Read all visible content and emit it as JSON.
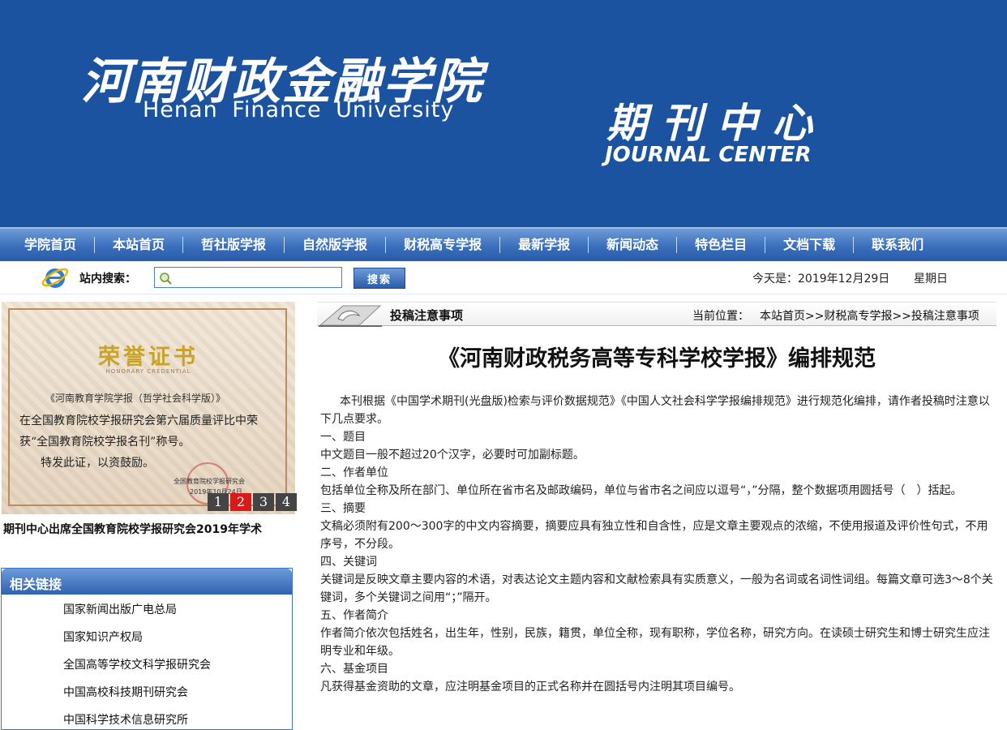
{
  "banner": {
    "logo_cn": "河南财政金融学院",
    "logo_en": "Henan Finance University",
    "center_cn": "期刊中心",
    "center_en": "JOURNAL CENTER",
    "background_color": "#1b53a0"
  },
  "nav": {
    "items": [
      "学院首页",
      "本站首页",
      "哲社版学报",
      "自然版学报",
      "财税高专学报",
      "最新学报",
      "新闻动态",
      "特色栏目",
      "文档下载",
      "联系我们"
    ]
  },
  "search": {
    "icon": "ie-icon",
    "label": "站内搜索：",
    "value": "",
    "button_label": "搜索"
  },
  "date": {
    "today": "今天是：2019年12月29日",
    "weekday": "星期日"
  },
  "slideshow": {
    "certificate": {
      "title": "荣誉证书",
      "subtitle": "HONORARY CREDENTIAL",
      "line1": "《河南教育学院学报（哲学社会科学版）》",
      "line2": "在全国教育院校学报研究会第六届质量评比中荣",
      "line3": "获“全国教育院校学报名刊”称号。",
      "line4": "特发此证，以资鼓励。",
      "issuer": "全国教育院校学报研究会",
      "date": "2019年10月24日"
    },
    "pages": [
      "1",
      "2",
      "3",
      "4"
    ],
    "active_page": "2",
    "caption": "期刊中心出席全国教育院校学报研究会2019年学术"
  },
  "links": {
    "title": "相关链接",
    "items": [
      "国家新闻出版广电总局",
      "国家知识产权局",
      "全国高等学校文科学报研究会",
      "中国高校科技期刊研究会",
      "中国科学技术信息研究所"
    ]
  },
  "breadcrumb": {
    "section_title": "投稿注意事项",
    "position_label": "当前位置：",
    "path": "本站首页>>财税高专学报>>投稿注意事项"
  },
  "article": {
    "title": "《河南财政税务高等专科学校学报》编排规范",
    "intro": "本刊根据《中国学术期刊(光盘版)检索与评价数据规范》《中国人文社会科学学报编排规范》进行规范化编排，请作者投稿时注意以下几点要求。",
    "sections": [
      {
        "heading": "一、题目",
        "text": "中文题目一般不超过20个汉字，必要时可加副标题。"
      },
      {
        "heading": "二、作者单位",
        "text": "包括单位全称及所在部门、单位所在省市名及邮政编码，单位与省市名之间应以逗号“，”分隔，整个数据项用圆括号（　）括起。"
      },
      {
        "heading": "三、摘要",
        "text": "文稿必须附有200～300字的中文内容摘要，摘要应具有独立性和自含性，应是文章主要观点的浓缩，不使用报道及评价性句式，不用序号，不分段。"
      },
      {
        "heading": "四、关键词",
        "text": "关键词是反映文章主要内容的术语，对表达论文主题内容和文献检索具有实质意义，一般为名词或名词性词组。每篇文章可选3～8个关键词，多个关键词之间用“；”隔开。"
      },
      {
        "heading": "五、作者简介",
        "text": "作者简介依次包括姓名，出生年，性别，民族，籍贯，单位全称，现有职称，学位名称，研究方向。在读硕士研究生和博士研究生应注明专业和年级。"
      },
      {
        "heading": "六、基金项目",
        "text": "凡获得基金资助的文章，应注明基金项目的正式名称并在圆括号内注明其项目编号。"
      }
    ]
  }
}
